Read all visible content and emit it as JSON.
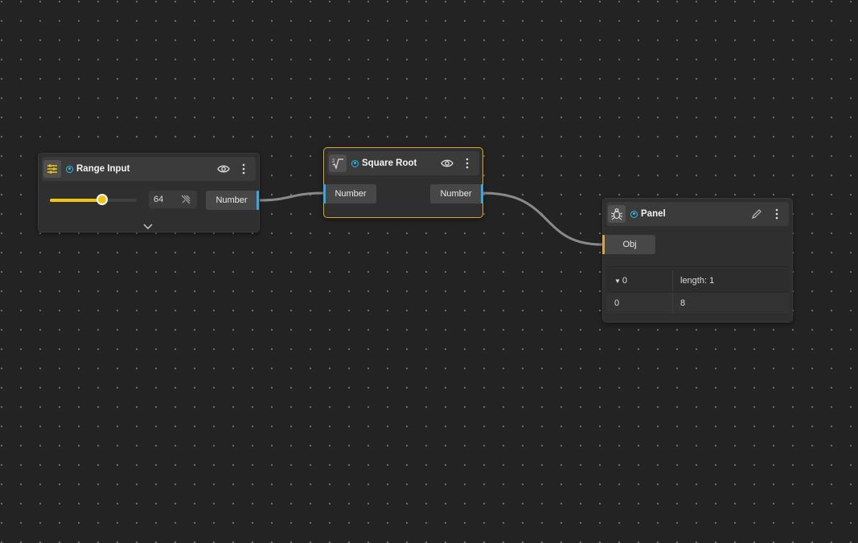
{
  "canvas": {
    "background": "#232323",
    "wire_color": "#8a8a8a",
    "port_color_number": "#3aa6e0",
    "port_color_obj": "#d9a24a",
    "selected_color": "#d9a622"
  },
  "nodes": {
    "range_input": {
      "title": "Range Input",
      "icon": "sliders-icon",
      "value": "64",
      "slider_fraction": 0.6,
      "output_label": "Number",
      "actions": [
        "eye-icon",
        "more-vertical-icon"
      ],
      "expand_icon": "chevron-down-icon",
      "pin_icon": "pin-off-icon"
    },
    "square_root": {
      "title": "Square Root",
      "icon": "square-root-icon",
      "input_label": "Number",
      "output_label": "Number",
      "selected": true,
      "actions": [
        "eye-icon",
        "more-vertical-icon"
      ]
    },
    "panel": {
      "title": "Panel",
      "icon": "bug-icon",
      "input_label": "Obj",
      "actions": [
        "pencil-icon",
        "more-vertical-icon"
      ],
      "table": {
        "header": {
          "key": "0",
          "value": "length: 1"
        },
        "rows": [
          {
            "key": "0",
            "value": "8"
          }
        ]
      }
    }
  }
}
